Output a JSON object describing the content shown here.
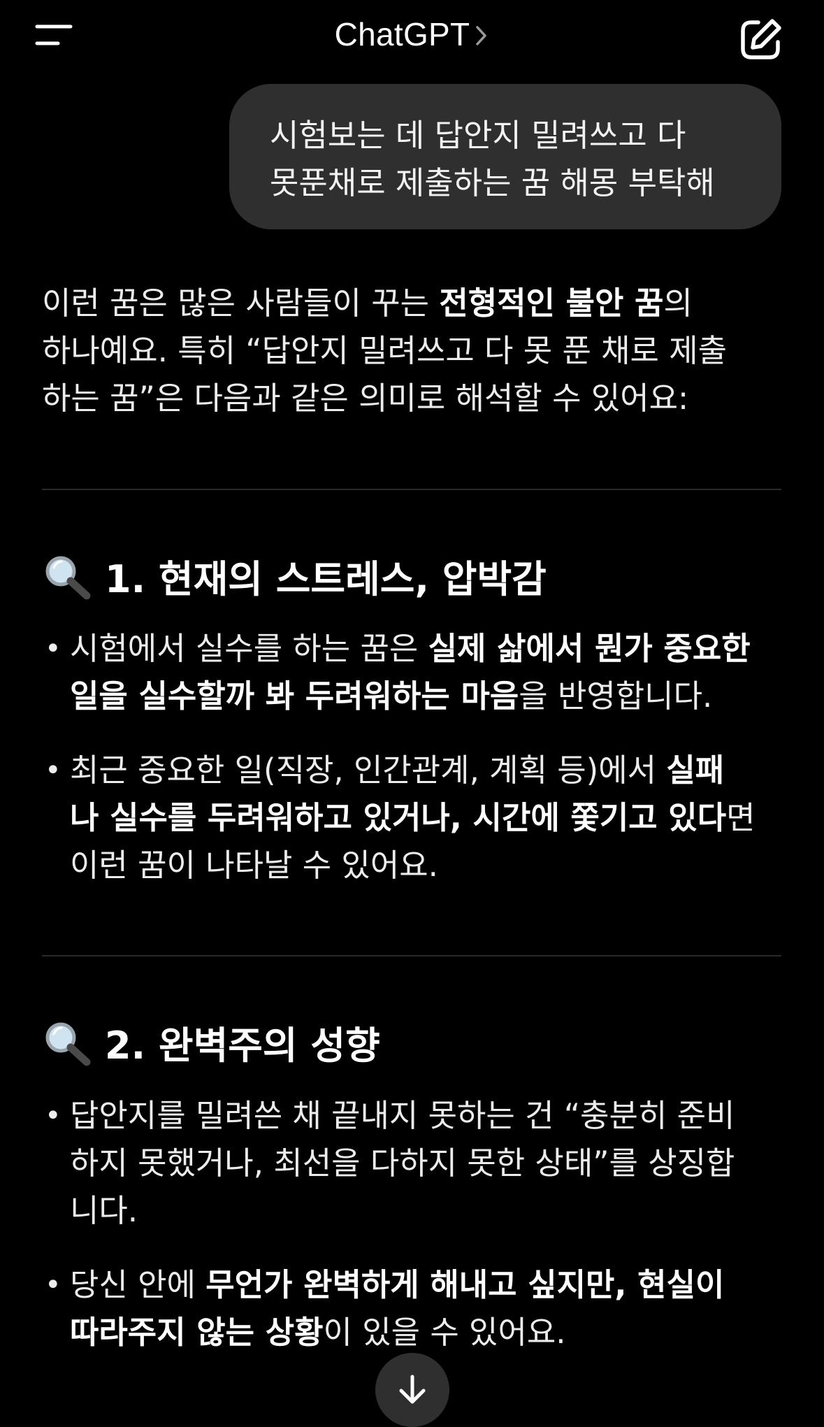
{
  "header": {
    "title": "ChatGPT",
    "menu_icon": "hamburger-menu-icon",
    "chevron_icon": "chevron-right-icon",
    "compose_icon": "new-chat-edit-icon"
  },
  "user_message": {
    "lines": [
      "시험보는 데 답안지 밀려쓰고 다",
      "못푼채로 제출하는 꿈 해몽 부탁해"
    ]
  },
  "response": {
    "intro": [
      {
        "p1": "이런 꿈은 많은 사람들이 꾸는 ",
        "b1": "전형적인 불안 꿈",
        "p2": "의"
      },
      {
        "p1": "하나예요. 특히 “답안지 밀려쓰고 다 못 푼 채로 제출"
      },
      {
        "p1": "하는 꿈”은 다음과 같은 의미로 해석할 수 있어요:"
      }
    ],
    "sections": [
      {
        "icon": "magnifying-glass-icon",
        "heading": "1. 현재의 스트레스, 압박감",
        "bullets": [
          [
            {
              "p1": "시험에서 실수를 하는 꿈은 ",
              "b1": "실제 삶에서 뭔가 중요한"
            },
            {
              "b1": "일을 실수할까 봐 두려워하는 마음",
              "p2": "을 반영합니다."
            }
          ],
          [
            {
              "p1": "최근 중요한 일(직장, 인간관계, 계획 등)에서 ",
              "b1": "실패"
            },
            {
              "b1": "나 실수를 두려워하고 있거나, 시간에 쫓기고 있다",
              "p2": "면"
            },
            {
              "p1": "이런 꿈이 나타날 수 있어요."
            }
          ]
        ]
      },
      {
        "icon": "magnifying-glass-icon",
        "heading": "2. 완벽주의 성향",
        "bullets": [
          [
            {
              "p1": "답안지를 밀려쓴 채 끝내지 못하는 건 “충분히 준비"
            },
            {
              "p1": "하지 못했거나, 최선을 다하지 못한 상태”를 상징합"
            },
            {
              "p1": "니다."
            }
          ],
          [
            {
              "p1": "당신 안에 ",
              "b1": "무언가 완벽하게 해내고 싶지만, 현실이"
            },
            {
              "b1": "따라주지 않는 상황",
              "p2": "이 있을 수 있어요."
            }
          ]
        ]
      }
    ]
  },
  "scroll_button_icon": "arrow-down-icon",
  "colors": {
    "background": "#000000",
    "bubble": "#2f2f2f",
    "text": "#ececec",
    "divider": "#2a2a2a"
  }
}
